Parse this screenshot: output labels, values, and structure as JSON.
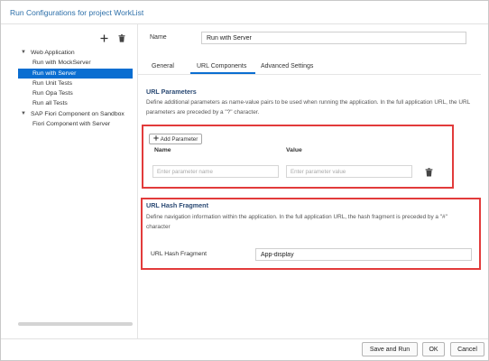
{
  "dialog": {
    "title": "Run Configurations for project WorkList"
  },
  "left_toolbar": {
    "add_icon": "plus-icon",
    "delete_icon": "trash-icon"
  },
  "tree": {
    "items": [
      {
        "label": "Web Application",
        "level": 0,
        "expanded": true
      },
      {
        "label": "Run with MockServer",
        "level": 1
      },
      {
        "label": "Run with Server",
        "level": 1,
        "selected": true
      },
      {
        "label": "Run Unit Tests",
        "level": 1
      },
      {
        "label": "Run Opa Tests",
        "level": 1
      },
      {
        "label": "Run all Tests",
        "level": 1
      },
      {
        "label": "SAP Fiori Component on Sandbox",
        "level": 0,
        "expanded": true
      },
      {
        "label": "Fiori Component with Server",
        "level": 1
      }
    ]
  },
  "form": {
    "name_label": "Name",
    "name_value": "Run with Server"
  },
  "tabs": [
    {
      "label": "General"
    },
    {
      "label": "URL Components",
      "active": true
    },
    {
      "label": "Advanced Settings"
    }
  ],
  "url_parameters": {
    "title": "URL Parameters",
    "description": "Define additional parameters as name-value pairs to be used when running the application. In the full application URL, the URL parameters are preceded by a \"?\" character.",
    "add_button": "Add Parameter",
    "col_name": "Name",
    "col_value": "Value",
    "name_placeholder": "Enter parameter name",
    "value_placeholder": "Enter parameter value"
  },
  "url_hash": {
    "title": "URL Hash Fragment",
    "description": "Define navigation information within the application. In the full application URL, the hash fragment is preceded by a \"#\" character",
    "label": "URL Hash Fragment",
    "value": "App-display"
  },
  "footer": {
    "save_run": "Save and Run",
    "ok": "OK",
    "cancel": "Cancel"
  },
  "colors": {
    "accent": "#0a6ed1",
    "title": "#2b6ea8",
    "section_title": "#2b4a74",
    "highlight_box": "#e23b3b"
  }
}
